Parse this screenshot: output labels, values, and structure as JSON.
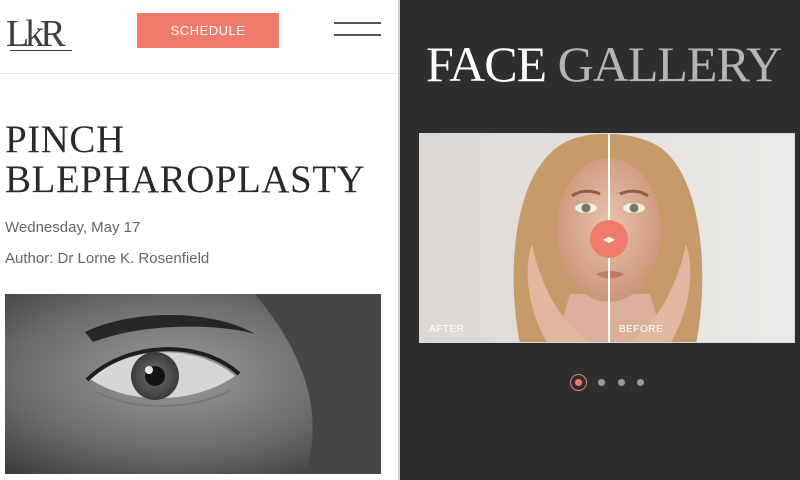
{
  "header": {
    "logo_text": "LkR",
    "schedule_label": "SCHEDULE",
    "menu_icon": "hamburger-menu-icon"
  },
  "article": {
    "title": "PINCH BLEPHAROPLASTY",
    "date": "Wednesday, May 17",
    "author": "Author: Dr Lorne K. Rosenfield"
  },
  "gallery": {
    "title_word1": "FACE",
    "title_word2": "GALLERY",
    "after_label": "AFTER",
    "before_label": "BEFORE",
    "handle_icon": "left-right-arrows-icon",
    "slide_count": 4,
    "active_slide": 1
  },
  "colors": {
    "accent": "#f07a6b",
    "gallery_bg": "#2e2e2e",
    "title_gray": "#b5b5b5",
    "text_dark": "#2a2a2a",
    "text_muted": "#666666"
  }
}
